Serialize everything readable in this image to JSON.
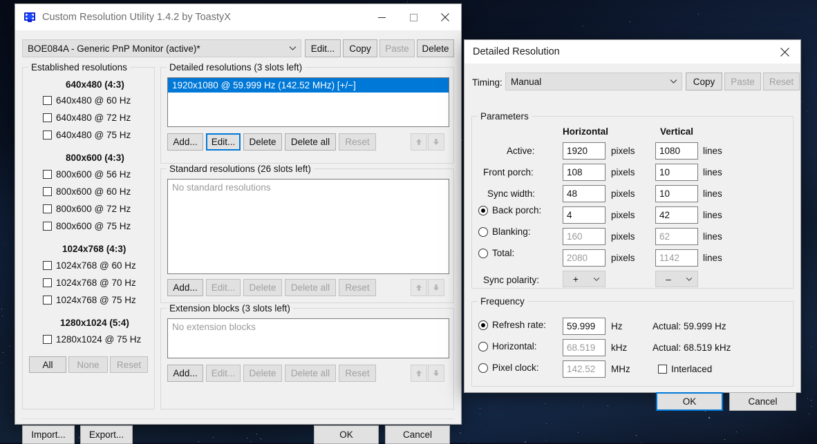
{
  "main_window": {
    "title": "Custom Resolution Utility 1.4.2 by ToastyX",
    "icon": "monitor-icon",
    "controls": {
      "minimize": "minimize-icon",
      "maximize": "maximize-icon",
      "close": "close-icon"
    },
    "monitor_select": {
      "value": "BOE084A - Generic PnP Monitor (active)*",
      "arrow": "chevron-down-icon"
    },
    "monitor_buttons": [
      {
        "label": "Edit...",
        "enabled": true
      },
      {
        "label": "Copy",
        "enabled": true
      },
      {
        "label": "Paste",
        "enabled": false
      },
      {
        "label": "Delete",
        "enabled": true
      }
    ],
    "established": {
      "title": "Established resolutions",
      "groups": [
        {
          "heading": "640x480 (4:3)",
          "items": [
            {
              "label": "640x480 @ 60 Hz",
              "checked": false
            },
            {
              "label": "640x480 @ 72 Hz",
              "checked": false
            },
            {
              "label": "640x480 @ 75 Hz",
              "checked": false
            }
          ]
        },
        {
          "heading": "800x600 (4:3)",
          "items": [
            {
              "label": "800x600 @ 56 Hz",
              "checked": false
            },
            {
              "label": "800x600 @ 60 Hz",
              "checked": false
            },
            {
              "label": "800x600 @ 72 Hz",
              "checked": false
            },
            {
              "label": "800x600 @ 75 Hz",
              "checked": false
            }
          ]
        },
        {
          "heading": "1024x768 (4:3)",
          "items": [
            {
              "label": "1024x768 @ 60 Hz",
              "checked": false
            },
            {
              "label": "1024x768 @ 70 Hz",
              "checked": false
            },
            {
              "label": "1024x768 @ 75 Hz",
              "checked": false
            }
          ]
        },
        {
          "heading": "1280x1024 (5:4)",
          "items": [
            {
              "label": "1280x1024 @ 75 Hz",
              "checked": false
            }
          ]
        }
      ],
      "buttons": [
        {
          "label": "All",
          "enabled": true
        },
        {
          "label": "None",
          "enabled": false
        },
        {
          "label": "Reset",
          "enabled": false
        }
      ]
    },
    "detailed": {
      "title": "Detailed resolutions (3 slots left)",
      "items": [
        "1920x1080 @ 59.999 Hz (142.52 MHz) [+/−]"
      ],
      "selected_index": 0,
      "buttons": [
        {
          "label": "Add...",
          "enabled": true,
          "focused": false
        },
        {
          "label": "Edit...",
          "enabled": true,
          "focused": true
        },
        {
          "label": "Delete",
          "enabled": true,
          "focused": false
        },
        {
          "label": "Delete all",
          "enabled": true,
          "focused": false
        },
        {
          "label": "Reset",
          "enabled": false,
          "focused": false
        }
      ],
      "move_up": "arrow-up-icon",
      "move_down": "arrow-down-icon"
    },
    "standard": {
      "title": "Standard resolutions (26 slots left)",
      "empty_text": "No standard resolutions",
      "buttons": [
        {
          "label": "Add...",
          "enabled": true
        },
        {
          "label": "Edit...",
          "enabled": false
        },
        {
          "label": "Delete",
          "enabled": false
        },
        {
          "label": "Delete all",
          "enabled": false
        },
        {
          "label": "Reset",
          "enabled": false
        }
      ],
      "move_up": "arrow-up-icon",
      "move_down": "arrow-down-icon"
    },
    "extension": {
      "title": "Extension blocks (3 slots left)",
      "empty_text": "No extension blocks",
      "buttons": [
        {
          "label": "Add...",
          "enabled": true
        },
        {
          "label": "Edit...",
          "enabled": false
        },
        {
          "label": "Delete",
          "enabled": false
        },
        {
          "label": "Delete all",
          "enabled": false
        },
        {
          "label": "Reset",
          "enabled": false
        }
      ],
      "move_up": "arrow-up-icon",
      "move_down": "arrow-down-icon"
    },
    "footer": {
      "import_label": "Import...",
      "export_label": "Export...",
      "ok_label": "OK",
      "cancel_label": "Cancel"
    }
  },
  "dialog": {
    "title": "Detailed Resolution",
    "close_icon": "close-icon",
    "timing": {
      "label": "Timing:",
      "value": "Manual",
      "arrow": "chevron-down-icon",
      "buttons": [
        {
          "label": "Copy",
          "enabled": true
        },
        {
          "label": "Paste",
          "enabled": false
        },
        {
          "label": "Reset",
          "enabled": false
        }
      ]
    },
    "parameters": {
      "title": "Parameters",
      "col_h": "Horizontal",
      "col_v": "Vertical",
      "unit_h": "pixels",
      "unit_v": "lines",
      "rows": [
        {
          "label": "Active:",
          "radio": null,
          "h": "1920",
          "v": "1080",
          "dim": false
        },
        {
          "label": "Front porch:",
          "radio": null,
          "h": "108",
          "v": "10",
          "dim": false
        },
        {
          "label": "Sync width:",
          "radio": null,
          "h": "48",
          "v": "10",
          "dim": false
        },
        {
          "label": "Back porch:",
          "radio": true,
          "h": "4",
          "v": "42",
          "dim": false
        },
        {
          "label": "Blanking:",
          "radio": false,
          "h": "160",
          "v": "62",
          "dim": true
        },
        {
          "label": "Total:",
          "radio": false,
          "h": "2080",
          "v": "1142",
          "dim": true
        }
      ],
      "sync_polarity": {
        "label": "Sync polarity:",
        "h": "+",
        "v": "–",
        "arrow": "chevron-down-icon"
      }
    },
    "frequency": {
      "title": "Frequency",
      "rows": [
        {
          "label": "Refresh rate:",
          "selected": true,
          "value": "59.999",
          "unit": "Hz",
          "dim": false,
          "actual": "Actual: 59.999 Hz"
        },
        {
          "label": "Horizontal:",
          "selected": false,
          "value": "68.519",
          "unit": "kHz",
          "dim": true,
          "actual": "Actual: 68.519 kHz"
        },
        {
          "label": "Pixel clock:",
          "selected": false,
          "value": "142.52",
          "unit": "MHz",
          "dim": true,
          "actual": ""
        }
      ],
      "interlaced": {
        "label": "Interlaced",
        "checked": false
      }
    },
    "ok_label": "OK",
    "cancel_label": "Cancel"
  },
  "colors": {
    "accent": "#0078d7",
    "window_face": "#f0f0f0",
    "titlebar": "#ffffff",
    "field": "#ffffff",
    "disabled_text": "#a0a0a0"
  }
}
